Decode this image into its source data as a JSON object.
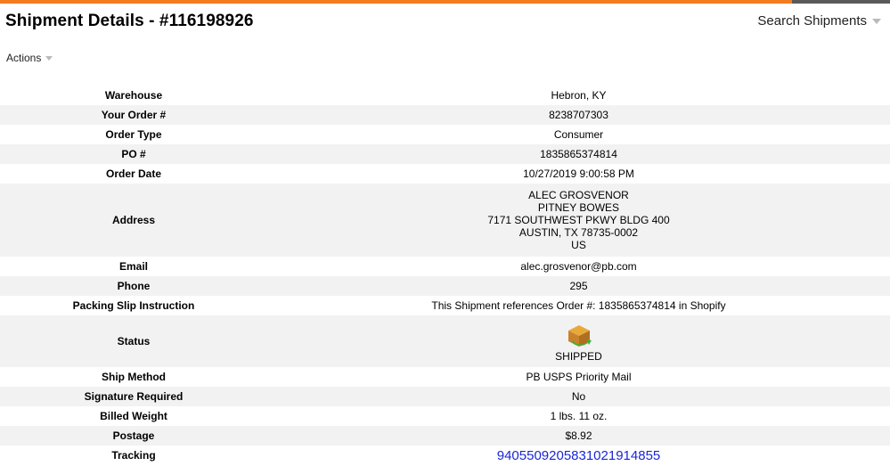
{
  "header": {
    "title": "Shipment Details - #116198926",
    "search_label": "Search Shipments",
    "actions_label": "Actions"
  },
  "details": {
    "warehouse": {
      "label": "Warehouse",
      "value": "Hebron, KY"
    },
    "order_num": {
      "label": "Your Order #",
      "value": "8238707303"
    },
    "order_type": {
      "label": "Order Type",
      "value": "Consumer"
    },
    "po": {
      "label": "PO #",
      "value": "1835865374814"
    },
    "order_date": {
      "label": "Order Date",
      "value": "10/27/2019 9:00:58 PM"
    },
    "address": {
      "label": "Address",
      "lines": [
        "ALEC GROSVENOR",
        "PITNEY BOWES",
        "7171 SOUTHWEST PKWY BLDG 400",
        "AUSTIN, TX 78735-0002",
        "US"
      ]
    },
    "email": {
      "label": "Email",
      "value": "alec.grosvenor@pb.com"
    },
    "phone": {
      "label": "Phone",
      "value": "295"
    },
    "packing_slip": {
      "label": "Packing Slip Instruction",
      "value": "This Shipment references Order #: 1835865374814 in Shopify"
    },
    "status": {
      "label": "Status",
      "value": "SHIPPED",
      "icon": "shipped-box-icon"
    },
    "ship_method": {
      "label": "Ship Method",
      "value": "PB USPS Priority Mail"
    },
    "signature": {
      "label": "Signature Required",
      "value": "No"
    },
    "billed_weight": {
      "label": "Billed Weight",
      "value": "1 lbs. 11 oz."
    },
    "postage": {
      "label": "Postage",
      "value": "$8.92"
    },
    "tracking": {
      "label": "Tracking",
      "value": "9405509205831021914855"
    }
  },
  "colors": {
    "accent": "#f47b20",
    "row_alt": "#f2f2f2",
    "link": "#1a26d6"
  }
}
